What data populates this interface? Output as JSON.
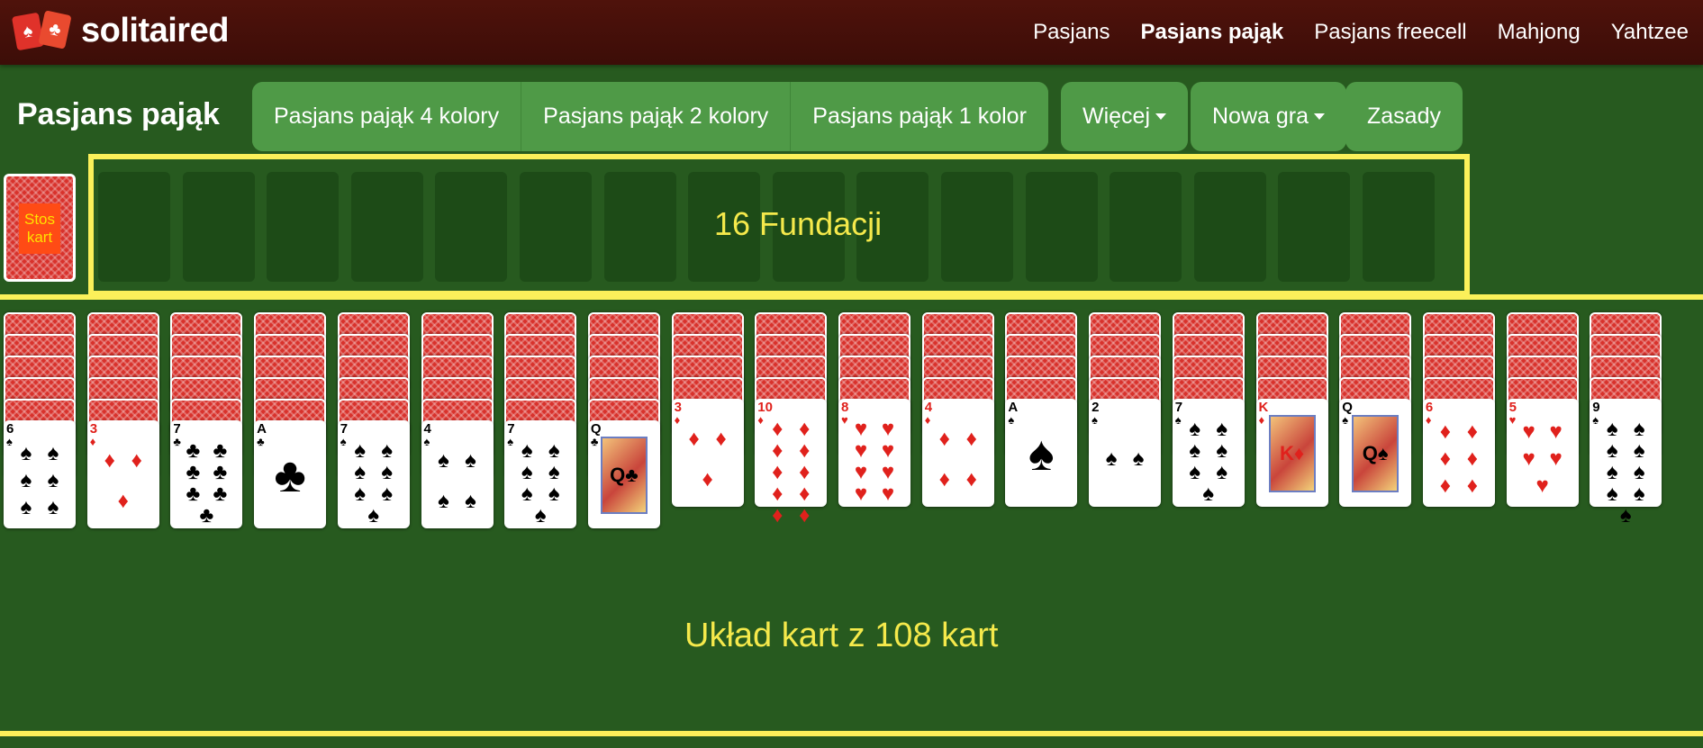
{
  "app": {
    "logo_text": "solitaired",
    "logo_suits": [
      "♠",
      "♣"
    ]
  },
  "nav": [
    {
      "label": "Pasjans",
      "active": false
    },
    {
      "label": "Pasjans pająk",
      "active": true
    },
    {
      "label": "Pasjans freecell",
      "active": false
    },
    {
      "label": "Mahjong",
      "active": false
    },
    {
      "label": "Yahtzee",
      "active": false
    }
  ],
  "page_title": "Pasjans pająk",
  "variant_buttons": [
    "Pasjans pająk 4 kolory",
    "Pasjans pająk 2 kolory",
    "Pasjans pająk 1 kolor"
  ],
  "more_button": "Więcej",
  "new_game_button": "Nowa gra",
  "rules_button": "Zasady",
  "stock": {
    "label_line1": "Stos",
    "label_line2": "kart"
  },
  "foundations": {
    "label": "16 Fundacji",
    "count": 16
  },
  "tableau": {
    "label": "Układ kart z 108 kart",
    "columns": [
      {
        "rank": "6",
        "suit": "♠",
        "color": "black",
        "face_down": 5
      },
      {
        "rank": "3",
        "suit": "♦",
        "color": "red",
        "face_down": 5
      },
      {
        "rank": "7",
        "suit": "♣",
        "color": "black",
        "face_down": 5
      },
      {
        "rank": "A",
        "suit": "♣",
        "color": "black",
        "face_down": 5
      },
      {
        "rank": "7",
        "suit": "♠",
        "color": "black",
        "face_down": 5
      },
      {
        "rank": "4",
        "suit": "♠",
        "color": "black",
        "face_down": 5
      },
      {
        "rank": "7",
        "suit": "♠",
        "color": "black",
        "face_down": 5
      },
      {
        "rank": "Q",
        "suit": "♣",
        "color": "black",
        "face_down": 5
      },
      {
        "rank": "3",
        "suit": "♦",
        "color": "red",
        "face_down": 4
      },
      {
        "rank": "10",
        "suit": "♦",
        "color": "red",
        "face_down": 4
      },
      {
        "rank": "8",
        "suit": "♥",
        "color": "red",
        "face_down": 4
      },
      {
        "rank": "4",
        "suit": "♦",
        "color": "red",
        "face_down": 4
      },
      {
        "rank": "A",
        "suit": "♠",
        "color": "black",
        "face_down": 4
      },
      {
        "rank": "2",
        "suit": "♠",
        "color": "black",
        "face_down": 4
      },
      {
        "rank": "7",
        "suit": "♠",
        "color": "black",
        "face_down": 4
      },
      {
        "rank": "K",
        "suit": "♦",
        "color": "red",
        "face_down": 4
      },
      {
        "rank": "Q",
        "suit": "♠",
        "color": "black",
        "face_down": 4
      },
      {
        "rank": "6",
        "suit": "♦",
        "color": "red",
        "face_down": 4
      },
      {
        "rank": "5",
        "suit": "♥",
        "color": "red",
        "face_down": 4
      },
      {
        "rank": "9",
        "suit": "♠",
        "color": "black",
        "face_down": 4
      }
    ]
  },
  "colors": {
    "felt": "#275a1f",
    "header": "#4f120b",
    "button": "#4f9a47",
    "highlight": "#fbf05a",
    "card_back": "#d8322c"
  }
}
